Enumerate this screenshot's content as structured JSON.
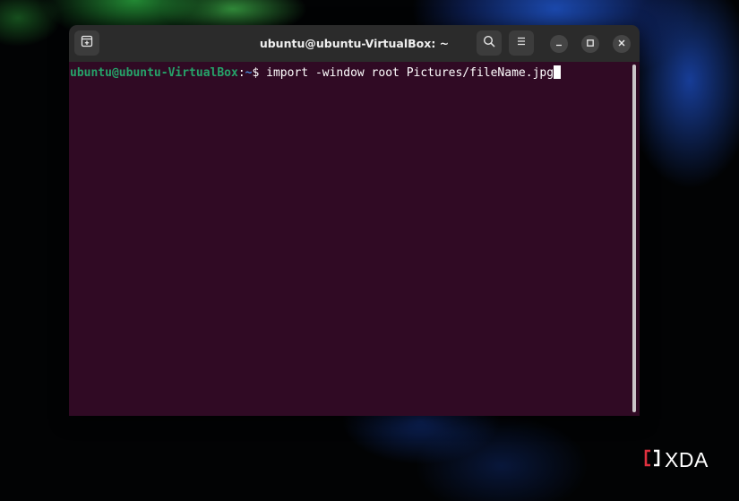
{
  "window": {
    "title": "ubuntu@ubuntu-VirtualBox: ~",
    "buttons": {
      "new_tab": "new-tab-icon",
      "search": "search-icon",
      "menu": "hamburger-menu-icon",
      "minimize": "minimize-icon",
      "maximize": "maximize-icon",
      "close": "close-icon"
    }
  },
  "terminal": {
    "prompt_user": "ubuntu@ubuntu-VirtualBox",
    "prompt_colon": ":",
    "prompt_path": "~",
    "prompt_symbol": "$ ",
    "command": "import -window root Pictures/fileName.jpg"
  },
  "watermark": {
    "text": "XDA"
  },
  "colors": {
    "terminal_bg": "#300a24",
    "prompt_user": "#26a269",
    "prompt_path": "#4a88d6",
    "headerbar": "#2b2b2b",
    "logo_accent": "#e0313f"
  }
}
